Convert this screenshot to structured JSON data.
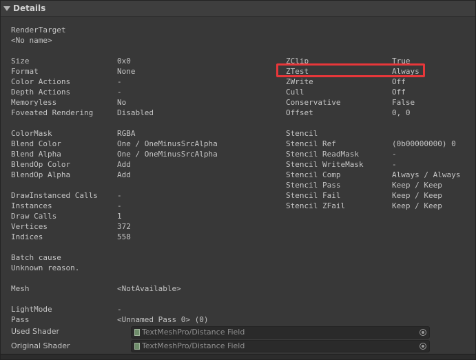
{
  "header": {
    "title": "Details"
  },
  "render_target": {
    "label": "RenderTarget",
    "value": "<No name>"
  },
  "left_rows": [
    {
      "label": "Size",
      "value": "0x0"
    },
    {
      "label": "Format",
      "value": "None"
    },
    {
      "label": "Color Actions",
      "value": "-"
    },
    {
      "label": "Depth Actions",
      "value": "-"
    },
    {
      "label": "Memoryless",
      "value": "No"
    },
    {
      "label": "Foveated Rendering",
      "value": "Disabled"
    },
    {
      "label": "ColorMask",
      "value": "RGBA"
    },
    {
      "label": "Blend Color",
      "value": "One / OneMinusSrcAlpha"
    },
    {
      "label": "Blend Alpha",
      "value": "One / OneMinusSrcAlpha"
    },
    {
      "label": "BlendOp Color",
      "value": "Add"
    },
    {
      "label": "BlendOp Alpha",
      "value": "Add"
    },
    {
      "label": "DrawInstanced Calls",
      "value": "-"
    },
    {
      "label": "Instances",
      "value": "-"
    },
    {
      "label": "Draw Calls",
      "value": "1"
    },
    {
      "label": "Vertices",
      "value": "372"
    },
    {
      "label": "Indices",
      "value": "558"
    }
  ],
  "right_rows": [
    {
      "label": "ZClip",
      "value": "True"
    },
    {
      "label": "ZTest",
      "value": "Always"
    },
    {
      "label": "ZWrite",
      "value": "Off"
    },
    {
      "label": "Cull",
      "value": "Off"
    },
    {
      "label": "Conservative",
      "value": "False"
    },
    {
      "label": "Offset",
      "value": "0, 0"
    },
    {
      "label": "Stencil",
      "value": ""
    },
    {
      "label": "Stencil Ref",
      "value": "(0b00000000) 0"
    },
    {
      "label": "Stencil ReadMask",
      "value": "-"
    },
    {
      "label": "Stencil WriteMask",
      "value": "-"
    },
    {
      "label": "Stencil Comp",
      "value": "Always / Always"
    },
    {
      "label": "Stencil Pass",
      "value": "Keep / Keep"
    },
    {
      "label": "Stencil Fail",
      "value": "Keep / Keep"
    },
    {
      "label": "Stencil ZFail",
      "value": "Keep / Keep"
    }
  ],
  "batch": {
    "label": "Batch cause",
    "value": "Unknown reason."
  },
  "mesh": {
    "label": "Mesh",
    "value": "<NotAvailable>"
  },
  "lightmode": {
    "label": "LightMode",
    "value": "-"
  },
  "pass": {
    "label": "Pass",
    "value": "<Unnamed Pass 0> (0)"
  },
  "used_shader": {
    "label": "Used Shader",
    "value": "TextMeshPro/Distance Field"
  },
  "original_shader": {
    "label": "Original Shader",
    "value": "TextMeshPro/Distance Field"
  },
  "colors": {
    "highlight": "#e8373a",
    "background": "#383838"
  }
}
